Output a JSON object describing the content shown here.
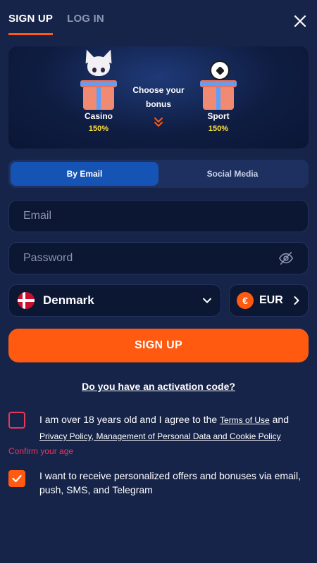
{
  "header": {
    "tabs": [
      {
        "label": "SIGN UP",
        "active": true
      },
      {
        "label": "LOG IN",
        "active": false
      }
    ]
  },
  "bonus": {
    "choose_label": "Choose your bonus",
    "options": [
      {
        "name": "Casino",
        "percent": "150%"
      },
      {
        "name": "Sport",
        "percent": "150%"
      }
    ]
  },
  "method": {
    "options": [
      {
        "label": "By Email",
        "active": true
      },
      {
        "label": "Social Media",
        "active": false
      }
    ]
  },
  "form": {
    "email_placeholder": "Email",
    "email_value": "",
    "password_placeholder": "Password",
    "password_value": "",
    "country": "Denmark",
    "currency_symbol": "€",
    "currency": "EUR",
    "submit_label": "SIGN UP",
    "activation_link": "Do you have an activation code?"
  },
  "consent": {
    "age": {
      "text_before": "I am over 18 years old and I agree to the ",
      "terms_link": "Terms of Use",
      "text_and": " and ",
      "privacy_link": "Privacy Policy, Management of Personal Data and Cookie Policy",
      "checked": false,
      "error": "Confirm your age"
    },
    "offers": {
      "text": "I want to receive personalized offers and bonuses via email, push, SMS, and Telegram",
      "checked": true
    }
  },
  "colors": {
    "background": "#172449",
    "accent": "#ff5a10",
    "active_method": "#1554b5",
    "error": "#e8365b",
    "bonus_percent": "#ffe03a"
  },
  "icons": {
    "close": "close-icon",
    "eye_off": "eye-off-icon",
    "chevron_down": "chevron-down-icon",
    "chevron_right": "chevron-right-icon",
    "choose_chevron": "double-chevron-down-icon"
  }
}
